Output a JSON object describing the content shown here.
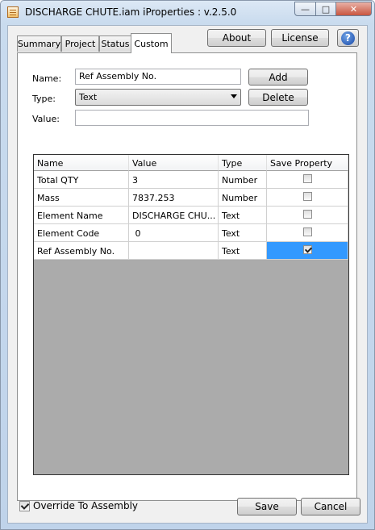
{
  "window": {
    "title": "DISCHARGE CHUTE.iam iProperties : v.2.5.0",
    "controls": {
      "minimize": "—",
      "maximize": "□",
      "close": "✕"
    }
  },
  "tabs": [
    {
      "label": "Summary",
      "active": false
    },
    {
      "label": "Project",
      "active": false
    },
    {
      "label": "Status",
      "active": false
    },
    {
      "label": "Custom",
      "active": true
    }
  ],
  "toolbar": {
    "about_label": "About",
    "license_label": "License",
    "help_glyph": "?"
  },
  "form": {
    "name_label": "Name:",
    "name_value": "Ref Assembly No.",
    "type_label": "Type:",
    "type_value": "Text",
    "value_label": "Value:",
    "value_value": "",
    "add_label": "Add",
    "delete_label": "Delete"
  },
  "grid": {
    "columns": [
      "Name",
      "Value",
      "Type",
      "Save Property"
    ],
    "rows": [
      {
        "name": "Total QTY",
        "value": "3",
        "type": "Number",
        "save": false
      },
      {
        "name": "Mass",
        "value": "7837.253",
        "type": "Number",
        "save": false
      },
      {
        "name": "Element Name",
        "value": "DISCHARGE CHU...",
        "type": "Text",
        "save": false
      },
      {
        "name": "Element Code",
        "value": " 0",
        "type": "Text",
        "save": false
      },
      {
        "name": "Ref Assembly No.",
        "value": "",
        "type": "Text",
        "save": true,
        "selected": true
      }
    ]
  },
  "footer": {
    "override_label": "Override To Assembly",
    "override_checked": true,
    "save_label": "Save",
    "cancel_label": "Cancel"
  }
}
